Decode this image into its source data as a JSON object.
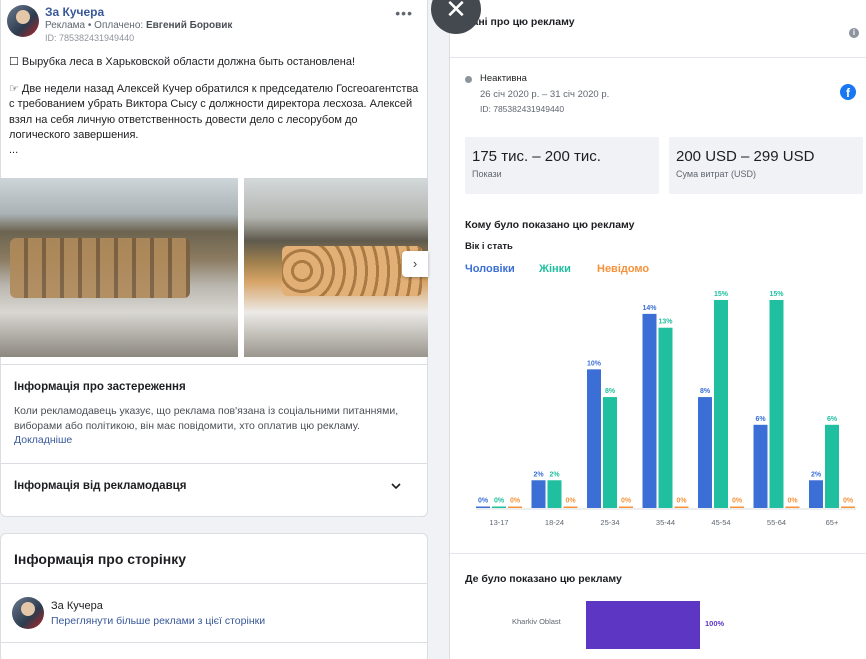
{
  "post": {
    "page_name": "За Кучера",
    "sponsored_prefix": "Реклама • Оплачено:",
    "paid_by": "Евгений Боровик",
    "ad_id": "ID: 785382431949440",
    "more": "•••",
    "paragraph1": "☐ Вырубка леса в Харьковской области должна быть остановлена!",
    "paragraph2": "☞ Две недели назад Алексей Кучер обратился к председателю Госгеоагентства с требованием убрать Виктора Сысу с должности директора лесхоза. Алексей взял на себя личную ответственность довести дело с лесорубом до логического завершения.",
    "ellipsis": "...",
    "next_arrow": "›"
  },
  "disclaimer": {
    "title": "Інформація про застереження",
    "text": "Коли рекламодавець указує, що реклама пов'язана із соціальними питаннями, виборами або політикою, він має повідомити, хто оплатив цю рекламу. ",
    "link": "Докладніше"
  },
  "advertiser": {
    "title": "Інформація від рекламодавця"
  },
  "page_info": {
    "title": "Інформація про сторінку",
    "name": "За Кучера",
    "link": "Переглянути більше реклами з цієї сторінки"
  },
  "close": "✕",
  "panel": {
    "title": "Дані про цю рекламу",
    "info_icon": "i",
    "status": "Неактивна",
    "dates": "26 січ 2020 р. – 31 січ 2020 р.",
    "id": "ID: 785382431949440",
    "fb_icon": "f",
    "impressions_value": "175 тис. – 200 тис.",
    "impressions_label": "Покази",
    "spend_value": "200 USD – 299 USD",
    "spend_label": "Сума витрат (USD)",
    "who_title": "Кому було показано цю рекламу",
    "age_gender": "Вік і стать",
    "where_title": "Де було показано цю рекламу",
    "region": "Kharkiv Oblast",
    "region_pct": "100%",
    "region_share": 1.0
  },
  "colors": {
    "men": "#3b6fd6",
    "women": "#1fbf9f",
    "unknown": "#f7923a",
    "region": "#5d37c4"
  },
  "chart_data": {
    "type": "bar",
    "categories": [
      "13-17",
      "18-24",
      "25-34",
      "35-44",
      "45-54",
      "55-64",
      "65+"
    ],
    "series": [
      {
        "name": "Чоловіки",
        "values": [
          0,
          2,
          10,
          14,
          8,
          6,
          2
        ]
      },
      {
        "name": "Жінки",
        "values": [
          0,
          2,
          8,
          13,
          15,
          15,
          6
        ]
      },
      {
        "name": "Невідомо",
        "values": [
          0,
          0,
          0,
          0,
          0,
          0,
          0
        ]
      }
    ],
    "ylim": [
      0,
      15
    ],
    "unit": "%"
  }
}
